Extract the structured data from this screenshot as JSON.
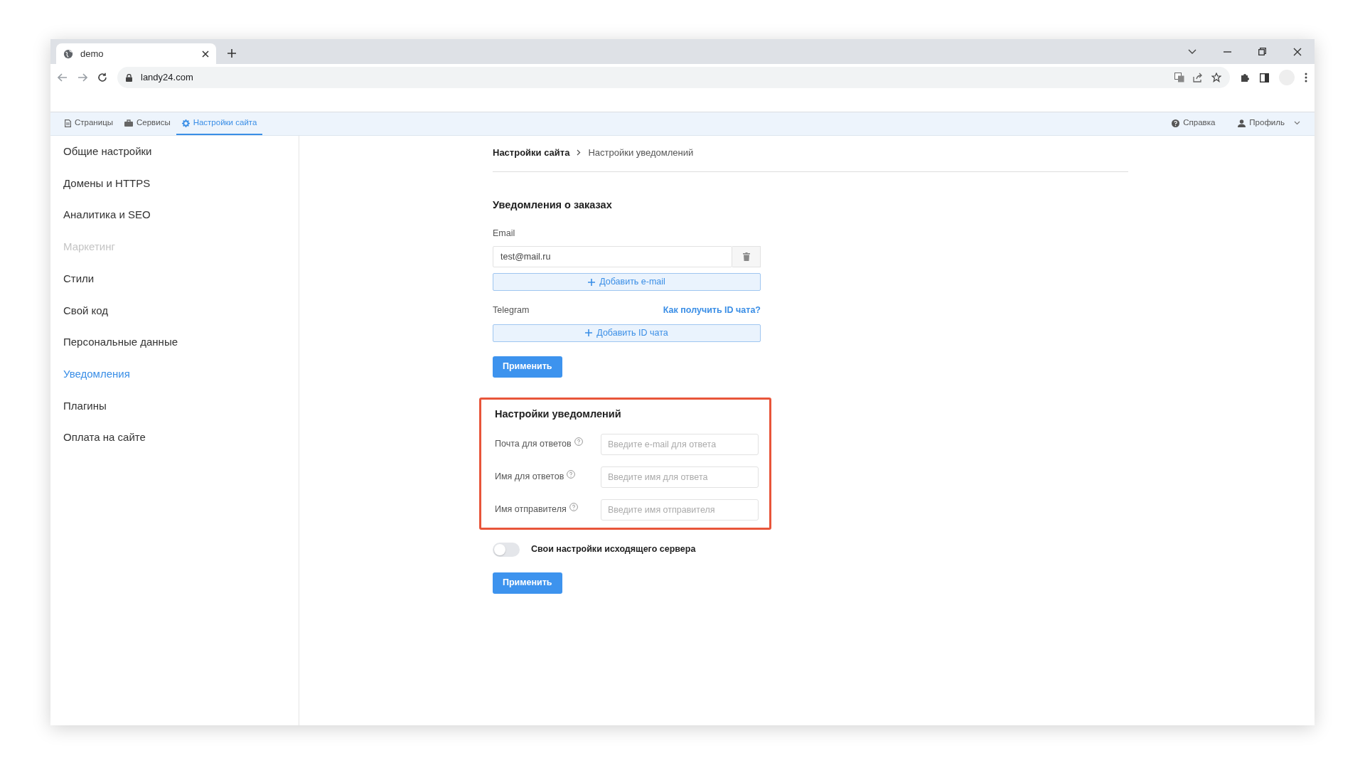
{
  "browser": {
    "tab_title": "demo",
    "url": "landy24.com"
  },
  "app_nav": {
    "items": [
      {
        "label": "Страницы",
        "selected": false
      },
      {
        "label": "Сервисы",
        "selected": false
      },
      {
        "label": "Настройки сайта",
        "selected": true
      }
    ],
    "help": "Справка",
    "profile": "Профиль"
  },
  "sidebar": {
    "items": [
      {
        "label": "Общие настройки",
        "selected": false,
        "disabled": false
      },
      {
        "label": "Домены и HTTPS",
        "selected": false,
        "disabled": false
      },
      {
        "label": "Аналитика и SEO",
        "selected": false,
        "disabled": false
      },
      {
        "label": "Маркетинг",
        "selected": false,
        "disabled": true
      },
      {
        "label": "Стили",
        "selected": false,
        "disabled": false
      },
      {
        "label": "Свой код",
        "selected": false,
        "disabled": false
      },
      {
        "label": "Персональные данные",
        "selected": false,
        "disabled": false
      },
      {
        "label": "Уведомления",
        "selected": true,
        "disabled": false
      },
      {
        "label": "Плагины",
        "selected": false,
        "disabled": false
      },
      {
        "label": "Оплата на сайте",
        "selected": false,
        "disabled": false
      }
    ]
  },
  "breadcrumb": [
    "Настройки сайта",
    "Настройки уведомлений"
  ],
  "orders": {
    "title": "Уведомления о заказах",
    "email_label": "Email",
    "emails": [
      {
        "value": "test@mail.ru"
      }
    ],
    "add_email": "Добавить e-mail",
    "telegram_label": "Telegram",
    "telegram_help": "Как получить ID чата?",
    "add_chat": "Добавить ID чата",
    "apply": "Применить"
  },
  "notification_settings": {
    "title": "Настройки уведомлений",
    "highlighted": true,
    "fields": [
      {
        "label": "Почта для ответов",
        "placeholder": "Введите e-mail для ответа"
      },
      {
        "label": "Имя для ответов",
        "placeholder": "Введите имя для ответа"
      },
      {
        "label": "Имя отправителя",
        "placeholder": "Введите имя отправителя"
      }
    ]
  },
  "smtp_toggle": {
    "label": "Свои настройки исходящего сервера",
    "on": false
  },
  "apply": "Применить"
}
